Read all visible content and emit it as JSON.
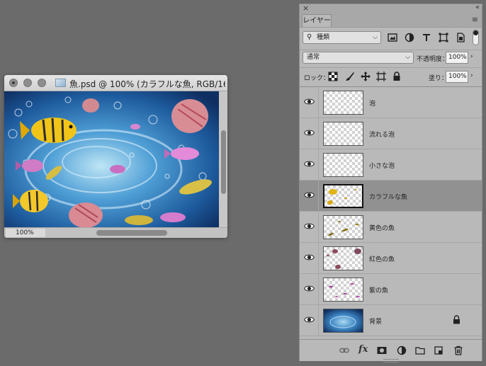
{
  "document": {
    "title": "魚.psd @ 100% (カラフルな魚, RGB/16...",
    "zoom": "100%"
  },
  "panel": {
    "tab_label": "レイヤー",
    "filter": {
      "kind_label": "種類"
    },
    "blend_mode": "通常",
    "opacity_label": "不透明度：",
    "opacity_value": "100%",
    "lock_label": "ロック：",
    "fill_label": "塗り：",
    "fill_value": "100%"
  },
  "layers": [
    {
      "name": "泡",
      "visible": true,
      "selected": false,
      "thumb": "empty"
    },
    {
      "name": "流れる泡",
      "visible": true,
      "selected": false,
      "thumb": "empty"
    },
    {
      "name": "小さな泡",
      "visible": true,
      "selected": false,
      "thumb": "empty"
    },
    {
      "name": "カラフルな魚",
      "visible": true,
      "selected": true,
      "thumb": "colorful"
    },
    {
      "name": "黄色の魚",
      "visible": true,
      "selected": false,
      "thumb": "yellow"
    },
    {
      "name": "紅色の魚",
      "visible": true,
      "selected": false,
      "thumb": "red"
    },
    {
      "name": "紫の魚",
      "visible": true,
      "selected": false,
      "thumb": "purple"
    },
    {
      "name": "背景",
      "visible": true,
      "selected": false,
      "thumb": "background",
      "locked": true
    }
  ],
  "colors": {
    "panel_bg": "#b9b9b9",
    "selected_row": "#919191",
    "workspace": "#6b6b6b"
  },
  "icons": {
    "panel": [
      "close-icon",
      "collapse-icon",
      "panel-menu-icon"
    ],
    "filter": [
      "search-icon",
      "image-filter-icon",
      "adjustment-filter-icon",
      "type-filter-icon",
      "shape-filter-icon",
      "smart-object-filter-icon",
      "filter-toggle-icon"
    ],
    "lock": [
      "lock-transparent-pixels-icon",
      "lock-image-pixels-icon",
      "lock-position-icon",
      "lock-artboard-icon",
      "lock-all-icon"
    ],
    "footer": [
      "link-layers-icon",
      "fx-icon",
      "add-mask-icon",
      "adjustment-layer-icon",
      "group-folder-icon",
      "new-layer-icon",
      "trash-icon"
    ]
  }
}
